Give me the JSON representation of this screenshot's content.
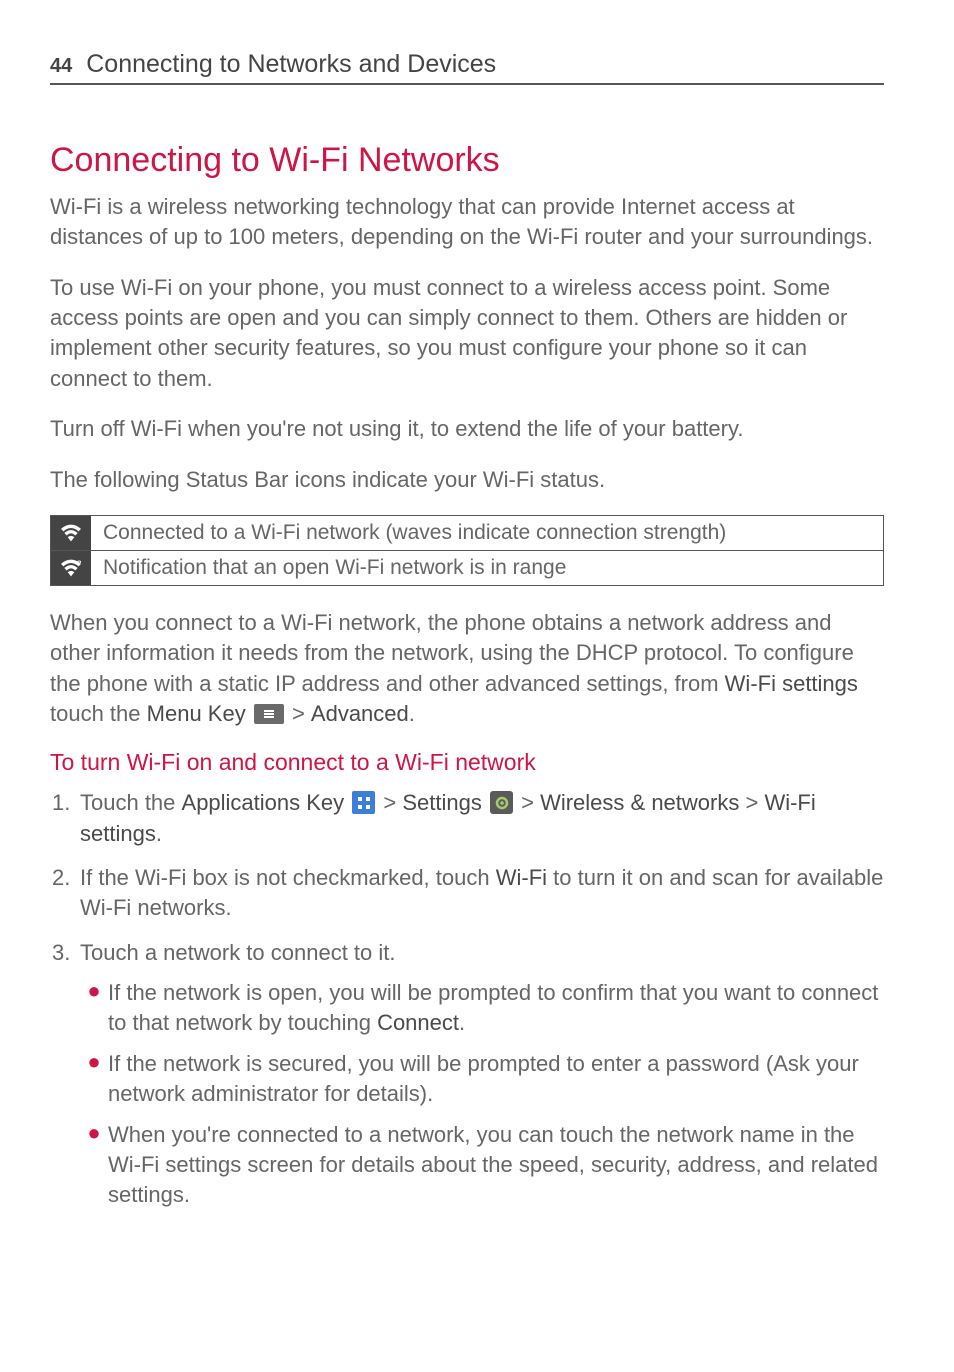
{
  "page_number": "44",
  "chapter_title": "Connecting to Networks and Devices",
  "section_title": "Connecting to Wi-Fi Networks",
  "para1": "Wi-Fi is a wireless networking technology that can provide Internet access at distances of up to 100 meters, depending on the Wi-Fi router and your surroundings.",
  "para2": "To use Wi-Fi on your phone, you must connect to a wireless access point. Some access points are open and you can simply connect to them. Others are hidden or implement other security features, so you must configure your phone so it can connect to them.",
  "para3": "Turn off Wi-Fi when you're not using it, to extend the life of your battery.",
  "para4": "The following Status Bar icons indicate your Wi-Fi status.",
  "icon_table": {
    "row1": "Connected to a Wi-Fi network (waves indicate connection strength)",
    "row2": "Notification that an open Wi-Fi network is in range"
  },
  "para5": {
    "t1": "When you connect to a Wi-Fi network, the phone obtains a network address and other information it needs from the network, using the DHCP protocol. To configure the phone with a static IP address and other advanced settings, from ",
    "b1": "Wi-Fi settings",
    "t2": " touch the ",
    "b2": "Menu Key",
    "t3": " > ",
    "b3": "Advanced",
    "t4": "."
  },
  "subsection_title": "To turn Wi-Fi on and connect to a Wi-Fi network",
  "step1": {
    "num": "1.",
    "t1": "Touch the ",
    "b1": "Applications Key",
    "t2": " > ",
    "b2": "Settings",
    "t3": " > ",
    "b3": "Wireless & networks",
    "t4": " > ",
    "b4": "Wi-Fi settings",
    "t5": "."
  },
  "step2": {
    "num": "2.",
    "t1": "If the Wi-Fi box is not checkmarked, touch ",
    "b1": "Wi-Fi",
    "t2": " to turn it on and scan for available Wi-Fi networks."
  },
  "step3": {
    "num": "3.",
    "t1": "Touch a network to connect to it."
  },
  "bullet1": {
    "t1": "If the network is open, you will be prompted to confirm that you want to connect to that network by touching ",
    "b1": "Connect",
    "t2": "."
  },
  "bullet2": {
    "t1": "If the network is secured, you will be prompted to enter a password (Ask your network administrator for details)."
  },
  "bullet3": {
    "t1": "When you're connected to a network, you can touch the network name in the Wi-Fi settings screen for details about the speed, security, address, and related settings."
  }
}
